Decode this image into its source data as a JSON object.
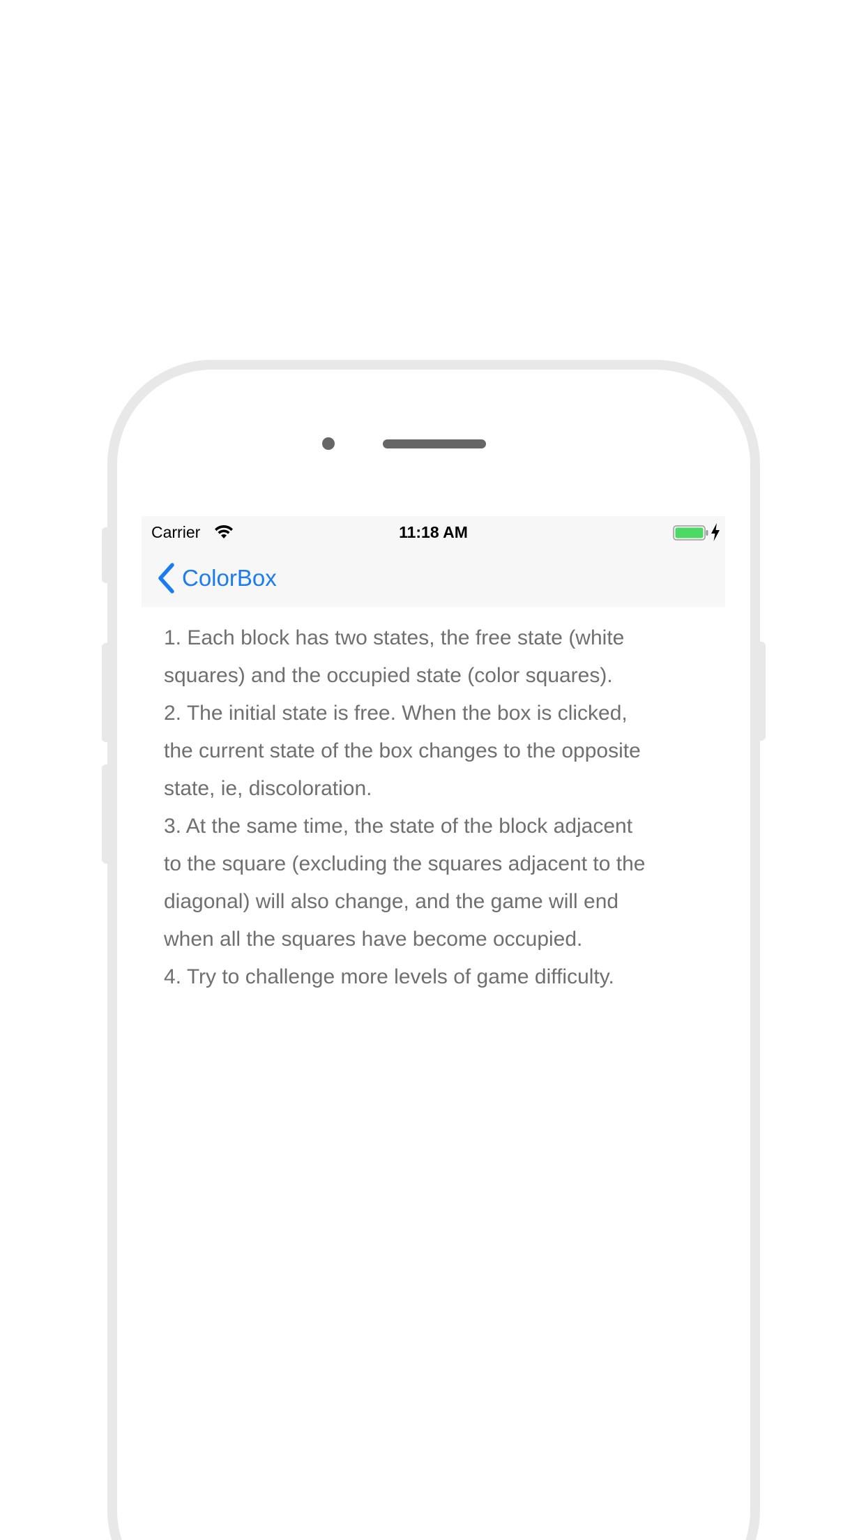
{
  "status_bar": {
    "carrier": "Carrier",
    "time": "11:18 AM",
    "wifi_icon": "wifi-icon",
    "battery_icon": "battery-icon",
    "battery_color": "#4cd964",
    "charging_icon": "charging-bolt-icon"
  },
  "navbar": {
    "back_label": "ColorBox",
    "back_icon": "chevron-left-icon",
    "accent_color": "#1a7cf4"
  },
  "content": {
    "lines": [
      "1. Each block has two states, the free state (white",
      "squares) and the occupied state (color squares).",
      "2. The initial state is free. When the box is clicked,",
      "the current state of the box changes to the opposite",
      "state, ie, discoloration.",
      "3. At the same time, the state of the block adjacent",
      "to the square (excluding the squares adjacent to the",
      "diagonal) will also change, and the game will end",
      "when all the squares have become occupied.",
      "4. Try to challenge more levels of game difficulty."
    ],
    "text_color": "#6f6f6f"
  }
}
